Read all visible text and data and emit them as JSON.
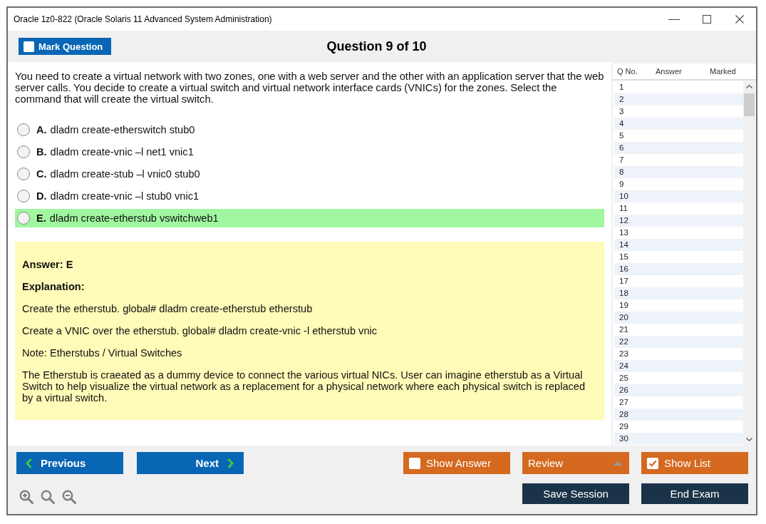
{
  "window": {
    "title": "Oracle 1z0-822 (Oracle Solaris 11 Advanced System Administration)"
  },
  "header": {
    "mark_question": {
      "label": "Mark Question",
      "checked": false
    },
    "title": "Question 9 of 10"
  },
  "question": {
    "text": "You need to create a virtual network with two zones, one with a web server and the other with an application server that the web server calls. You decide to create a virtual switch and virtual network interface cards (VNICs) for the zones. Select the command that will create the virtual switch.",
    "options": [
      {
        "letter": "A.",
        "text": "dladm create-etherswitch stub0",
        "selected": false,
        "correct": false
      },
      {
        "letter": "B.",
        "text": "dladm create-vnic –l net1 vnic1",
        "selected": false,
        "correct": false
      },
      {
        "letter": "C.",
        "text": "dladm create-stub –l vnic0 stub0",
        "selected": false,
        "correct": false
      },
      {
        "letter": "D.",
        "text": "dladm create-vnic –l stub0 vnic1",
        "selected": false,
        "correct": false
      },
      {
        "letter": "E.",
        "text": "dladm create-etherstub vswitchweb1",
        "selected": false,
        "correct": true
      }
    ]
  },
  "answer_panel": {
    "answer": "Answer: E",
    "explanation_label": "Explanation:",
    "paragraphs": [
      "Create the etherstub. global# dladm create-etherstub etherstub",
      "Create a VNIC over the etherstub. global# dladm create-vnic -l etherstub vnic",
      "Note: Etherstubs / Virtual Switches",
      "The Etherstub is craeated as a dummy device to connect the various virtual NICs. User can imagine etherstub as a Virtual Switch to help visualize the virtual network as a replacement for a physical network where each physical switch is replaced by a virtual switch."
    ]
  },
  "question_list": {
    "columns": [
      "Q No.",
      "Answer",
      "Marked"
    ],
    "rows": [
      {
        "number": "1"
      },
      {
        "number": "2"
      },
      {
        "number": "3"
      },
      {
        "number": "4"
      },
      {
        "number": "5"
      },
      {
        "number": "6"
      },
      {
        "number": "7"
      },
      {
        "number": "8"
      },
      {
        "number": "9"
      },
      {
        "number": "10"
      },
      {
        "number": "11"
      },
      {
        "number": "12"
      },
      {
        "number": "13"
      },
      {
        "number": "14"
      },
      {
        "number": "15"
      },
      {
        "number": "16"
      },
      {
        "number": "17"
      },
      {
        "number": "18"
      },
      {
        "number": "19"
      },
      {
        "number": "20"
      },
      {
        "number": "21"
      },
      {
        "number": "22"
      },
      {
        "number": "23"
      },
      {
        "number": "24"
      },
      {
        "number": "25"
      },
      {
        "number": "26"
      },
      {
        "number": "27"
      },
      {
        "number": "28"
      },
      {
        "number": "29"
      },
      {
        "number": "30"
      }
    ]
  },
  "navigation": {
    "previous": "Previous",
    "next": "Next"
  },
  "actions": {
    "show_answer": {
      "label": "Show Answer",
      "checked": false
    },
    "review": {
      "label": "Review"
    },
    "show_list": {
      "label": "Show List",
      "checked": true
    },
    "save_session": "Save Session",
    "end_exam": "End Exam"
  }
}
